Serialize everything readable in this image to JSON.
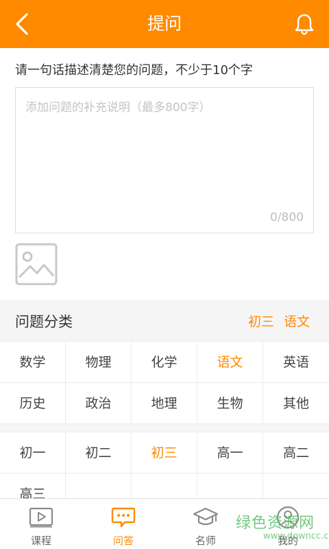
{
  "header": {
    "title": "提问"
  },
  "question": {
    "prompt": "请一句话描述清楚您的问题，不少于10个字",
    "placeholder": "添加问题的补充说明（最多800字）",
    "value": "",
    "counter": "0/800"
  },
  "category": {
    "label": "问题分类",
    "selected_grade": "初三",
    "selected_subject": "语文"
  },
  "subjects": [
    {
      "label": "数学",
      "active": false
    },
    {
      "label": "物理",
      "active": false
    },
    {
      "label": "化学",
      "active": false
    },
    {
      "label": "语文",
      "active": true
    },
    {
      "label": "英语",
      "active": false
    },
    {
      "label": "历史",
      "active": false
    },
    {
      "label": "政治",
      "active": false
    },
    {
      "label": "地理",
      "active": false
    },
    {
      "label": "生物",
      "active": false
    },
    {
      "label": "其他",
      "active": false
    }
  ],
  "grades": [
    {
      "label": "初一",
      "active": false
    },
    {
      "label": "初二",
      "active": false
    },
    {
      "label": "初三",
      "active": true
    },
    {
      "label": "高一",
      "active": false
    },
    {
      "label": "高二",
      "active": false
    },
    {
      "label": "高三",
      "active": false
    },
    {
      "label": "",
      "active": false
    },
    {
      "label": "",
      "active": false
    },
    {
      "label": "",
      "active": false
    },
    {
      "label": "",
      "active": false
    }
  ],
  "tabbar": {
    "courses": "课程",
    "qa": "问答",
    "teachers": "名师",
    "mine": "我的"
  },
  "watermark": {
    "line1": "绿色资源网",
    "line2": "www.downcc.com"
  },
  "colors": {
    "accent": "#ff8a00",
    "watermark": "#5cc06a"
  }
}
